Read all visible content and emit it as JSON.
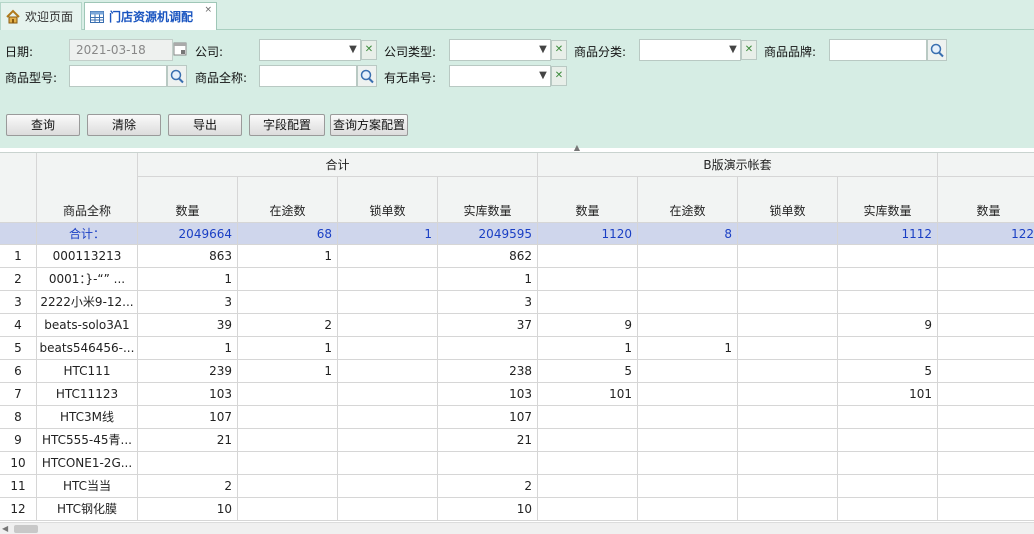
{
  "tabs": [
    {
      "label": "欢迎页面",
      "icon": "home-icon"
    },
    {
      "label": "门店资源机调配",
      "icon": "table-icon",
      "close": "×"
    }
  ],
  "filters": {
    "date_label": "日期:",
    "date_value": "2021-03-18",
    "company_label": "公司:",
    "company_type_label": "公司类型:",
    "category_label": "商品分类:",
    "brand_label": "商品品牌:",
    "model_label": "商品型号:",
    "fullname_label": "商品全称:",
    "serial_label": "有无串号:"
  },
  "buttons": {
    "query": "查询",
    "clear": "清除",
    "export": "导出",
    "field_config": "字段配置",
    "scheme_config": "查询方案配置"
  },
  "grid": {
    "col_name": "商品全称",
    "group_total": "合计",
    "group_b": "B版演示帐套",
    "sub_cols": [
      "数量",
      "在途数",
      "锁单数",
      "实库数量",
      "数量",
      "在途数",
      "锁单数",
      "实库数量",
      "数量"
    ],
    "summary": {
      "label": "合计：",
      "values": [
        "2049664",
        "68",
        "1",
        "2049595",
        "1120",
        "8",
        "",
        "1112",
        "122"
      ]
    },
    "rows": [
      {
        "n": "1",
        "name": "000113213",
        "v": [
          "863",
          "1",
          "",
          "862",
          "",
          "",
          "",
          "",
          ""
        ]
      },
      {
        "n": "2",
        "name": "0001：}-“”  ...",
        "v": [
          "1",
          "",
          "",
          "1",
          "",
          "",
          "",
          "",
          ""
        ]
      },
      {
        "n": "3",
        "name": "2222小米9-12...",
        "v": [
          "3",
          "",
          "",
          "3",
          "",
          "",
          "",
          "",
          ""
        ]
      },
      {
        "n": "4",
        "name": "beats-solo3A1",
        "v": [
          "39",
          "2",
          "",
          "37",
          "9",
          "",
          "",
          "9",
          ""
        ]
      },
      {
        "n": "5",
        "name": "beats546456-...",
        "v": [
          "1",
          "1",
          "",
          "",
          "1",
          "1",
          "",
          "",
          ""
        ]
      },
      {
        "n": "6",
        "name": "HTC111",
        "v": [
          "239",
          "1",
          "",
          "238",
          "5",
          "",
          "",
          "5",
          ""
        ]
      },
      {
        "n": "7",
        "name": "HTC11123",
        "v": [
          "103",
          "",
          "",
          "103",
          "101",
          "",
          "",
          "101",
          ""
        ]
      },
      {
        "n": "8",
        "name": "HTC3M线",
        "v": [
          "107",
          "",
          "",
          "107",
          "",
          "",
          "",
          "",
          ""
        ]
      },
      {
        "n": "9",
        "name": "HTC555-45青...",
        "v": [
          "21",
          "",
          "",
          "21",
          "",
          "",
          "",
          "",
          ""
        ]
      },
      {
        "n": "10",
        "name": "HTCONE1-2G...",
        "v": [
          "",
          "",
          "",
          "",
          "",
          "",
          "",
          "",
          ""
        ]
      },
      {
        "n": "11",
        "name": "HTC当当",
        "v": [
          "2",
          "",
          "",
          "2",
          "",
          "",
          "",
          "",
          ""
        ]
      },
      {
        "n": "12",
        "name": "HTC钢化膜",
        "v": [
          "10",
          "",
          "",
          "10",
          "",
          "",
          "",
          "",
          ""
        ]
      }
    ]
  },
  "colors": {
    "accent": "#1a55c0",
    "panel": "#d6ede4",
    "summary_bg": "#cfd6ec"
  }
}
